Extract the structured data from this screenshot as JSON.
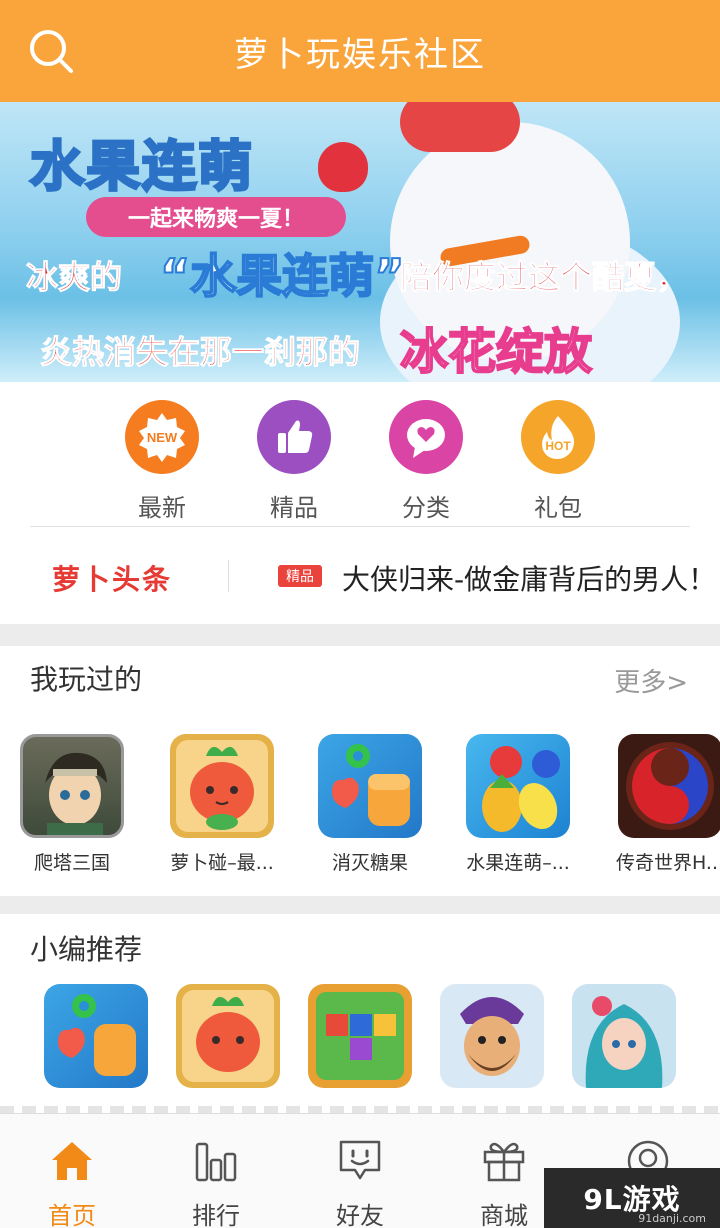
{
  "header": {
    "title": "萝卜玩娱乐社区",
    "search_icon": "search-icon"
  },
  "banner": {
    "logo": "水果连萌",
    "ribbon": "一起来畅爽一夏！",
    "line1_a": "冰爽的",
    "line1_q": "“水果连萌”",
    "line1_b": "陪你度过这个酷夏，",
    "line2_a": "炎热消失在那一刹那的",
    "line2_b": "冰花绽放"
  },
  "nav": [
    {
      "label": "最新",
      "icon": "new-icon",
      "color": "#f57c1f",
      "badge": "NEW"
    },
    {
      "label": "精品",
      "icon": "thumbs-up-icon",
      "color": "#9b4fc1",
      "badge": ""
    },
    {
      "label": "分类",
      "icon": "heart-bubble-icon",
      "color": "#d944a5",
      "badge": ""
    },
    {
      "label": "礼包",
      "icon": "hot-icon",
      "color": "#f4a52a",
      "badge": "HOT"
    }
  ],
  "headline": {
    "brand": "萝卜头条",
    "tag": "精品",
    "text": "大侠归来-做金庸背后的男人！"
  },
  "played": {
    "title": "我玩过的",
    "more": "更多>",
    "apps": [
      {
        "name": "爬塔三国"
      },
      {
        "name": "萝卜碰–最..."
      },
      {
        "name": "消灭糖果"
      },
      {
        "name": "水果连萌–..."
      },
      {
        "name": "传奇世界H..."
      }
    ]
  },
  "recommend": {
    "title": "小编推荐"
  },
  "tabs": [
    {
      "label": "首页",
      "icon": "home-icon",
      "active": true
    },
    {
      "label": "排行",
      "icon": "bar-chart-icon",
      "active": false
    },
    {
      "label": "好友",
      "icon": "chat-face-icon",
      "active": false
    },
    {
      "label": "商城",
      "icon": "gift-icon",
      "active": false
    },
    {
      "label": "",
      "icon": "profile-icon",
      "active": false
    }
  ],
  "watermark": {
    "text": "9L游戏",
    "url": "91danji.com"
  },
  "colors": {
    "primary": "#f9a53c",
    "accent": "#f28a17",
    "headline_red": "#e63a34"
  }
}
